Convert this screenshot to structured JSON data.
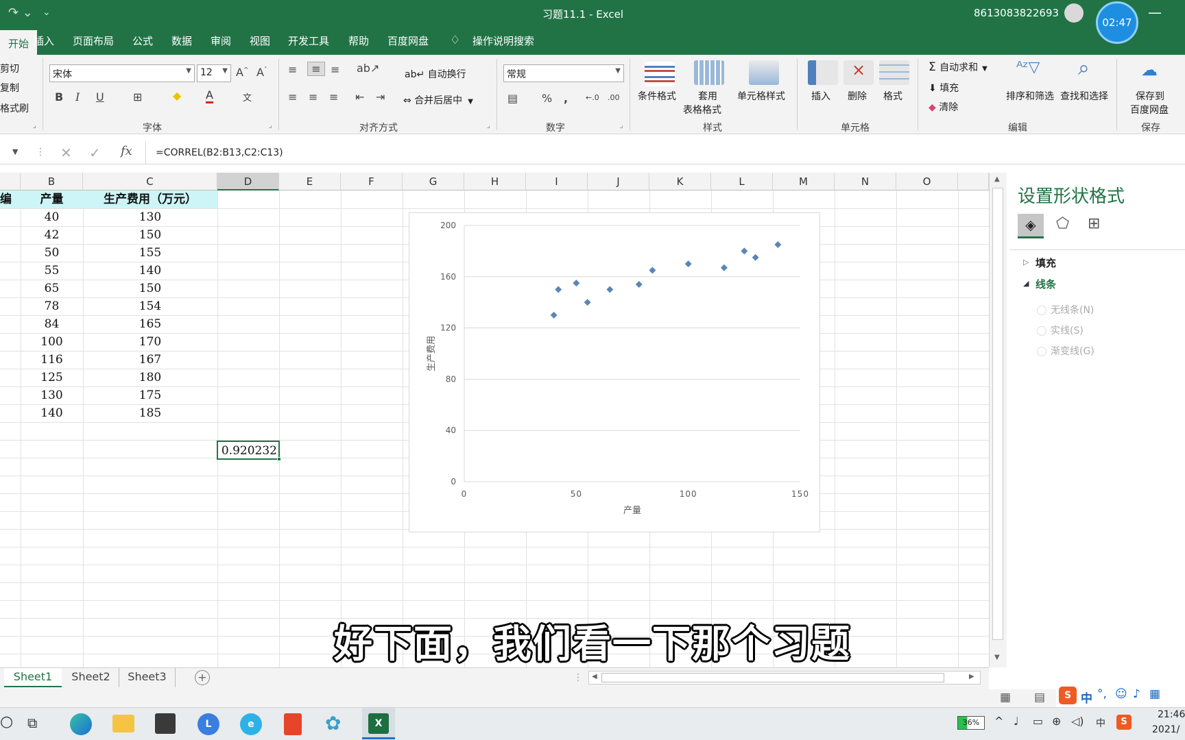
{
  "window": {
    "title": "习题11.1  -  Excel",
    "account": "8613083822693",
    "recording_timer": "02:47"
  },
  "ribbon_tabs": [
    {
      "label": "开始",
      "active": true
    },
    {
      "label": "插入"
    },
    {
      "label": "页面布局"
    },
    {
      "label": "公式"
    },
    {
      "label": "数据"
    },
    {
      "label": "审阅"
    },
    {
      "label": "视图"
    },
    {
      "label": "开发工具"
    },
    {
      "label": "帮助"
    },
    {
      "label": "百度网盘"
    },
    {
      "label": "操作说明搜索"
    }
  ],
  "ribbon": {
    "clipboard": {
      "cut": "剪切",
      "copy": "复制",
      "painter": "格式刷"
    },
    "font": {
      "name": "宋体",
      "size": "12",
      "group": "字体"
    },
    "alignment": {
      "wrap": "自动换行",
      "merge": "合并后居中",
      "group": "对齐方式"
    },
    "number": {
      "format": "常规",
      "group": "数字"
    },
    "styles": {
      "conditional": "条件格式",
      "table_l1": "套用",
      "table_l2": "表格格式",
      "cell_styles": "单元格样式",
      "group": "样式"
    },
    "cells": {
      "insert": "插入",
      "delete": "删除",
      "format": "格式",
      "group": "单元格"
    },
    "editing": {
      "autosum": "自动求和",
      "fill": "填充",
      "clear": "清除",
      "sort": "排序和筛选",
      "find": "查找和选择",
      "group": "编辑"
    },
    "save": {
      "line1": "保存到",
      "line2": "百度网盘",
      "group": "保存"
    }
  },
  "formula_bar": {
    "formula": "=CORREL(B2:B13,C2:C13)"
  },
  "columns": [
    "B",
    "C",
    "D",
    "E",
    "F",
    "G",
    "H",
    "I",
    "J",
    "K",
    "L",
    "M",
    "N",
    "O"
  ],
  "table": {
    "col_a_partial": "编",
    "header_b": "产量",
    "header_c": "生产费用（万元）",
    "rows": [
      {
        "b": "40",
        "c": "130"
      },
      {
        "b": "42",
        "c": "150"
      },
      {
        "b": "50",
        "c": "155"
      },
      {
        "b": "55",
        "c": "140"
      },
      {
        "b": "65",
        "c": "150"
      },
      {
        "b": "78",
        "c": "154"
      },
      {
        "b": "84",
        "c": "165"
      },
      {
        "b": "100",
        "c": "170"
      },
      {
        "b": "116",
        "c": "167"
      },
      {
        "b": "125",
        "c": "180"
      },
      {
        "b": "130",
        "c": "175"
      },
      {
        "b": "140",
        "c": "185"
      }
    ],
    "result": "0.920232"
  },
  "chart_data": {
    "type": "scatter",
    "title": "",
    "xlabel": "产量",
    "ylabel": "生产费用",
    "xlim": [
      0,
      150
    ],
    "ylim": [
      0,
      200
    ],
    "x_ticks": [
      "0",
      "50",
      "100",
      "150"
    ],
    "y_ticks": [
      "0",
      "40",
      "80",
      "120",
      "160",
      "200"
    ],
    "grid": "horizontal",
    "marker": "diamond",
    "series_color": "#5b86b5",
    "x": [
      40,
      42,
      50,
      55,
      65,
      78,
      84,
      100,
      116,
      125,
      130,
      140
    ],
    "y": [
      130,
      150,
      155,
      140,
      150,
      154,
      165,
      170,
      167,
      180,
      175,
      185
    ]
  },
  "format_panel": {
    "title": "设置形状格式",
    "fill": "填充",
    "line": "线条",
    "options": [
      "无线条(N)",
      "实线(S)",
      "渐变线(G)"
    ]
  },
  "sheets": [
    "Sheet1",
    "Sheet2",
    "Sheet3"
  ],
  "subtitle": "好下面，我们看一下那个习题",
  "taskbar": {
    "battery": "36%",
    "time": "21:46",
    "date": "2021/",
    "ime": "中"
  },
  "colors": {
    "excel_green": "#217346",
    "header_fill": "#cdf5f7",
    "scatter_blue": "#5b86b5"
  }
}
